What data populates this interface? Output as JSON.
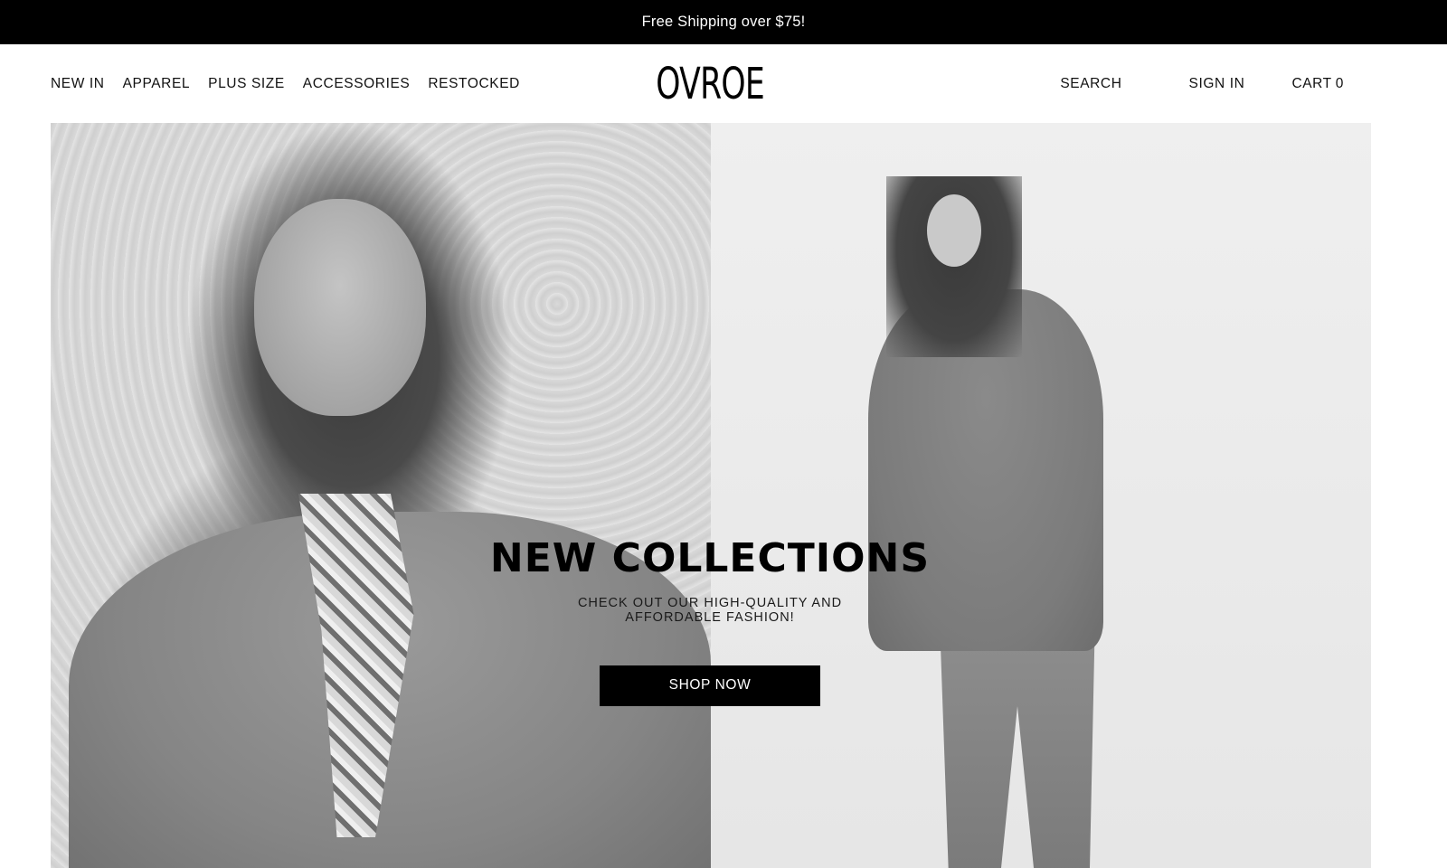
{
  "announcement": {
    "text": "Free Shipping over $75!"
  },
  "header": {
    "nav": [
      {
        "label": "NEW IN"
      },
      {
        "label": "APPAREL"
      },
      {
        "label": "PLUS SIZE"
      },
      {
        "label": "ACCESSORIES"
      },
      {
        "label": "RESTOCKED"
      }
    ],
    "logo": "OVROE",
    "search_label": "SEARCH",
    "signin_label": "SIGN IN",
    "cart_label": "CART",
    "cart_count": "0"
  },
  "hero": {
    "title": "NEW COLLECTIONS",
    "subtitle": "CHECK OUT OUR HIGH-QUALITY AND AFFORDABLE FASHION!",
    "cta_label": "SHOP NOW",
    "images": [
      {
        "name": "model-in-scarf-photo"
      },
      {
        "name": "model-in-belted-coat-photo"
      }
    ]
  },
  "colors": {
    "announcement_bg": "#000000",
    "announcement_text": "#ffffff",
    "cta_bg": "#000000",
    "cta_text": "#ffffff",
    "page_bg": "#ffffff"
  }
}
